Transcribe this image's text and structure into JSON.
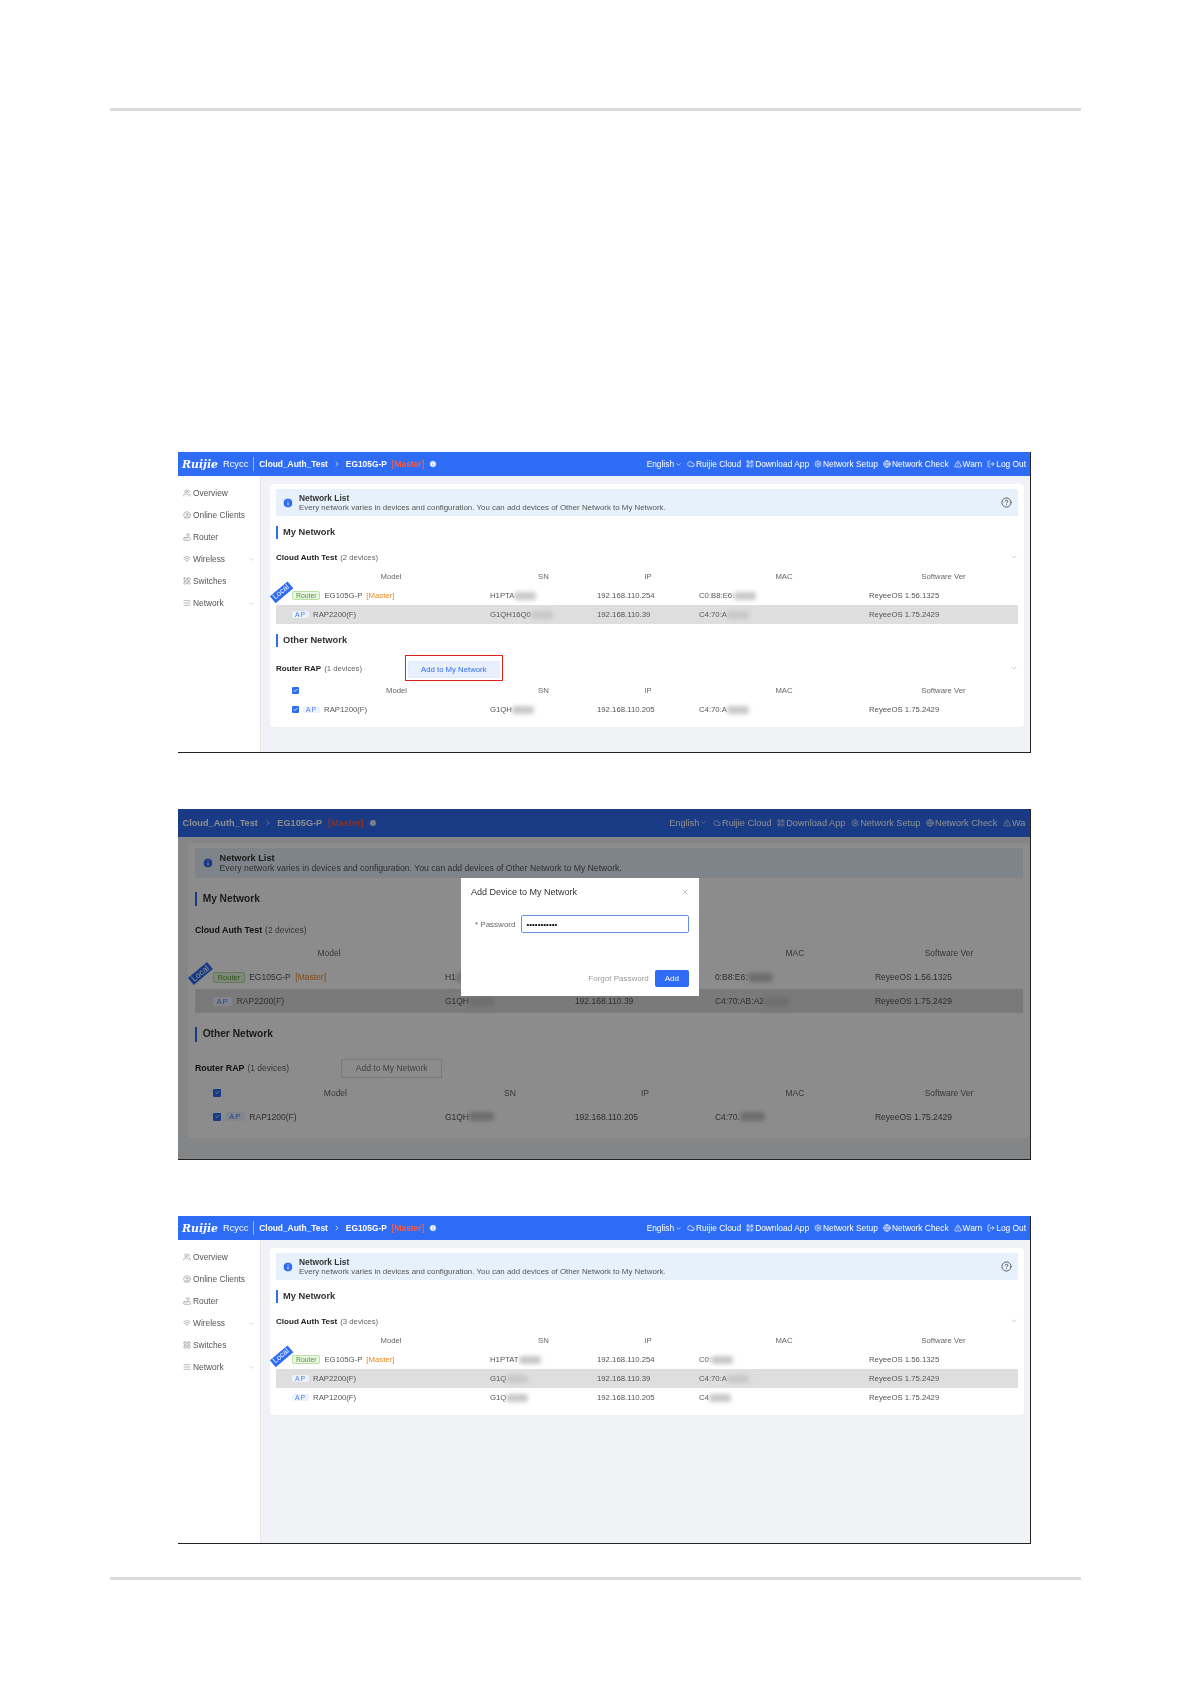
{
  "screenshots": [
    {
      "kind": "full",
      "topbar": {
        "logo": "Ruijie",
        "brand": "Rcycc",
        "crumbs": [
          "Cloud_Auth_Test",
          "EG105G-P"
        ],
        "badge": "[Master]",
        "links": [
          "English",
          "Ruijie Cloud",
          "Download App",
          "Network Setup",
          "Network Check",
          "Warn",
          "Log Out"
        ]
      },
      "sidebar": [
        {
          "label": "Overview",
          "expandable": false
        },
        {
          "label": "Online Clients",
          "expandable": false
        },
        {
          "label": "Router",
          "expandable": false
        },
        {
          "label": "Wireless",
          "expandable": true
        },
        {
          "label": "Switches",
          "expandable": false
        },
        {
          "label": "Network",
          "expandable": true
        }
      ],
      "notice": {
        "title": "Network List",
        "text": "Every network varies in devices and configuration. You can add devices of Other Network to My Network.",
        "help": true
      },
      "sections": [
        {
          "title": "My Network",
          "groups": [
            {
              "name": "Cloud Auth Test",
              "count": "(2 devices)",
              "collapsible": true,
              "columns": {
                "model": "Model",
                "sn": "SN",
                "ip": "IP",
                "mac": "MAC",
                "software": "Software Ver"
              },
              "rows": [
                {
                  "kind": "router",
                  "tag": "Router",
                  "ribbon": "Local",
                  "model": "EG105G-P",
                  "role": "[Master]",
                  "sn": "H1PTA",
                  "ip": "192.168.110.254",
                  "mac": "C0:B8:E6:",
                  "software": "ReyeeOS 1.56.1325",
                  "hovered": false
                },
                {
                  "kind": "ap",
                  "tag": "AP",
                  "model": "RAP2200(F)",
                  "sn": "G1QH16Q0",
                  "ip": "192.168.110.39",
                  "mac": "C4:70:A",
                  "software": "ReyeeOS 1.75.2429",
                  "hovered": true
                }
              ]
            }
          ]
        },
        {
          "title": "Other Network",
          "groups": [
            {
              "name": "Router RAP",
              "count": "(1 devices)",
              "action": {
                "label": "Add to My Network",
                "highlighted": true
              },
              "collapsible": true,
              "all_checked": true,
              "columns": {
                "model": "Model",
                "sn": "SN",
                "ip": "IP",
                "mac": "MAC",
                "software": "Software Ver"
              },
              "rows": [
                {
                  "kind": "ap",
                  "tag": "AP",
                  "model": "RAP1200(F)",
                  "sn": "G1QH",
                  "ip": "192.168.110.205",
                  "mac": "C4:70:A",
                  "software": "ReyeeOS 1.75.2429",
                  "hovered": false,
                  "checked": true
                }
              ]
            }
          ]
        }
      ]
    },
    {
      "kind": "zoomed",
      "topbar": {
        "crumbs": [
          "Cloud_Auth_Test",
          "EG105G-P"
        ],
        "badge": "[Master]",
        "links": [
          "English",
          "Ruijie Cloud",
          "Download App",
          "Network Setup",
          "Network Check",
          "Wa"
        ]
      },
      "notice": {
        "title": "Network List",
        "text": "Every network varies in devices and configuration. You can add devices of Other Network to My Network.",
        "help": false
      },
      "sections": [
        {
          "title": "My Network",
          "groups": [
            {
              "name": "Cloud Auth Test",
              "count": "(2 devices)",
              "collapsible": false,
              "columns": {
                "model": "Model",
                "mac": "MAC",
                "software": "Software Ver"
              },
              "rows": [
                {
                  "kind": "router",
                  "tag": "Router",
                  "ribbon": "Local",
                  "model": "EG105G-P",
                  "role": "[Master]",
                  "sn": "H1",
                  "mac": "0:B8:E6:",
                  "software": "ReyeeOS 1.56.1325",
                  "hovered": false
                },
                {
                  "kind": "ap",
                  "tag": "AP",
                  "model": "RAP2200(F)",
                  "sn": "G1QH",
                  "ip": "192.168.110.39",
                  "mac": "C4:70:AB:A2",
                  "software": "ReyeeOS 1.75.2429",
                  "hovered": true
                }
              ]
            }
          ]
        },
        {
          "title": "Other Network",
          "groups": [
            {
              "name": "Router RAP",
              "count": "(1 devices)",
              "action": {
                "label": "Add to My Network",
                "highlighted": false
              },
              "collapsible": false,
              "all_checked": true,
              "columns": {
                "model": "Model",
                "sn": "SN",
                "ip": "IP",
                "mac": "MAC",
                "software": "Software Ver"
              },
              "rows": [
                {
                  "kind": "ap",
                  "tag": "AP",
                  "model": "RAP1200(F)",
                  "sn": "G1QH",
                  "ip": "192.168.110.205",
                  "mac": "C4:70.",
                  "software": "ReyeeOS 1.75.2429",
                  "hovered": false,
                  "checked": true
                }
              ]
            }
          ]
        }
      ],
      "dialog": {
        "title": "Add Device to My Network",
        "label": "* Password",
        "value": "•••••••••••",
        "link": "Forgot Password",
        "button": "Add"
      }
    },
    {
      "kind": "full",
      "topbar": {
        "logo": "Ruijie",
        "brand": "Rcycc",
        "crumbs": [
          "Cloud_Auth_Test",
          "EG105G-P"
        ],
        "badge": "[Master]",
        "links": [
          "English",
          "Ruijie Cloud",
          "Download App",
          "Network Setup",
          "Network Check",
          "Warn",
          "Log Out"
        ]
      },
      "sidebar": [
        {
          "label": "Overview",
          "expandable": false
        },
        {
          "label": "Online Clients",
          "expandable": false
        },
        {
          "label": "Router",
          "expandable": false
        },
        {
          "label": "Wireless",
          "expandable": true
        },
        {
          "label": "Switches",
          "expandable": false
        },
        {
          "label": "Network",
          "expandable": true
        }
      ],
      "notice": {
        "title": "Network List",
        "text": "Every network varies in devices and configuration. You can add devices of Other Network to My Network.",
        "help": true
      },
      "sections": [
        {
          "title": "My Network",
          "groups": [
            {
              "name": "Cloud Auth Test",
              "count": "(3 devices)",
              "collapsible": true,
              "columns": {
                "model": "Model",
                "sn": "SN",
                "ip": "IP",
                "mac": "MAC",
                "software": "Software Ver"
              },
              "rows": [
                {
                  "kind": "router",
                  "tag": "Router",
                  "ribbon": "Local",
                  "model": "EG105G-P",
                  "role": "[Master]",
                  "sn": "H1PTAT",
                  "ip": "192.168.110.254",
                  "mac": "C0:",
                  "software": "ReyeeOS 1.56.1325",
                  "hovered": false
                },
                {
                  "kind": "ap",
                  "tag": "AP",
                  "model": "RAP2200(F)",
                  "sn": "G1Q",
                  "ip": "192.168.110.39",
                  "mac": "C4:70:A",
                  "software": "ReyeeOS 1.75.2429",
                  "hovered": true
                },
                {
                  "kind": "ap",
                  "tag": "AP",
                  "model": "RAP1200(F)",
                  "sn": "G1Q",
                  "ip": "192.168.110.205",
                  "mac": "C4",
                  "software": "ReyeeOS 1.75.2429",
                  "hovered": false
                }
              ]
            }
          ]
        }
      ]
    }
  ]
}
